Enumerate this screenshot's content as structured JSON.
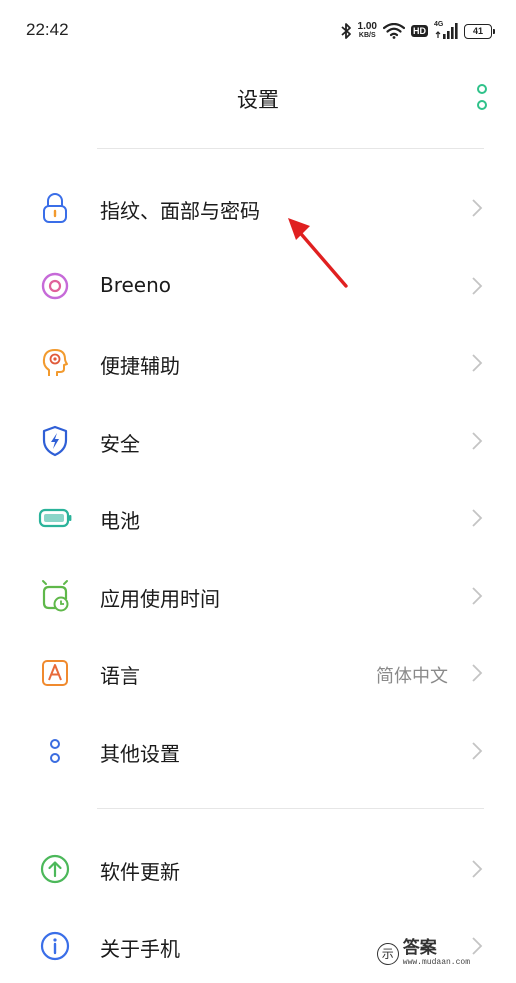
{
  "status_bar": {
    "time": "22:42",
    "net_speed_value": "1.00",
    "net_speed_unit": "KB/S",
    "hd_badge": "HD",
    "network_type": "4G",
    "battery_level": "41",
    "icons": [
      "bluetooth-icon",
      "wifi-icon",
      "signal-icon",
      "battery-icon"
    ]
  },
  "header": {
    "title": "设置",
    "more_icon": "more-vertical-icon",
    "accent_color": "#2fc28a"
  },
  "menu": {
    "items": [
      {
        "label": "指纹、面部与密码",
        "icon": "lock-icon",
        "color": "#3a6ee8"
      },
      {
        "label": "Breeno",
        "icon": "breeno-icon",
        "color": "#c66ad8"
      },
      {
        "label": "便捷辅助",
        "icon": "accessibility-head-icon",
        "color": "#f29a2e"
      },
      {
        "label": "安全",
        "icon": "shield-lightning-icon",
        "color": "#2f5fd6"
      },
      {
        "label": "电池",
        "icon": "battery-icon",
        "color": "#2ab39a"
      },
      {
        "label": "应用使用时间",
        "icon": "alarm-clock-icon",
        "color": "#5fb84a"
      },
      {
        "label": "语言",
        "value": "简体中文",
        "icon": "language-a-icon",
        "color": "#f08a2e"
      },
      {
        "label": "其他设置",
        "icon": "more-settings-icon",
        "color": "#3b6de0"
      },
      {
        "label": "软件更新",
        "icon": "update-arrow-icon",
        "color": "#4cb85a"
      },
      {
        "label": "关于手机",
        "icon": "info-icon",
        "color": "#3a6ee8"
      }
    ]
  },
  "watermark": {
    "logo_char": "示",
    "text": "答案",
    "url": "www.mudaan.com"
  },
  "annotation": {
    "color": "#e02020"
  }
}
